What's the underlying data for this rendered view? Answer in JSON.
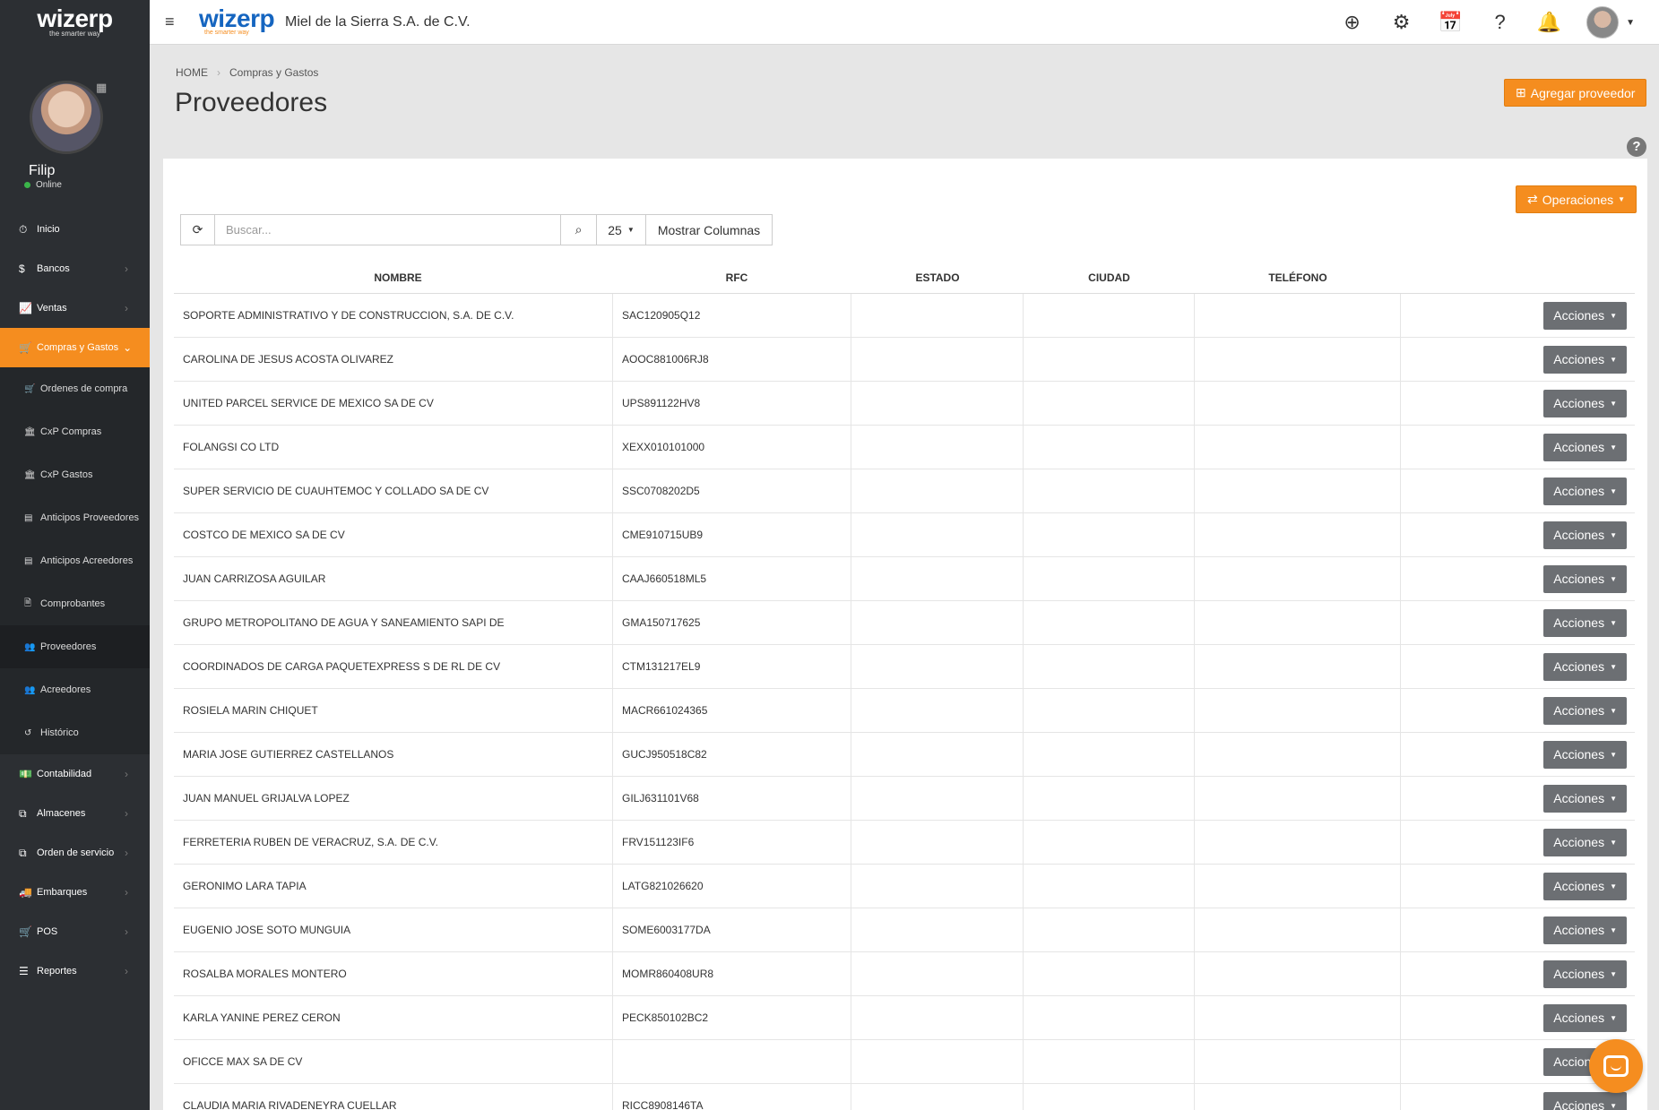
{
  "sidebar": {
    "logo": {
      "word": "wizerp",
      "tag": "the smarter way"
    },
    "user": {
      "name": "Filip",
      "status": "Online"
    },
    "nav_top": [
      {
        "label": "Inicio",
        "icon": "dashboard-icon",
        "glyph": "⏱",
        "chevron": ""
      },
      {
        "label": "Bancos",
        "icon": "dollar-icon",
        "glyph": "$",
        "chevron": "›"
      },
      {
        "label": "Ventas",
        "icon": "line-chart-icon",
        "glyph": "📈",
        "chevron": "›"
      }
    ],
    "active_item": {
      "label": "Compras y Gastos",
      "icon": "cart-icon",
      "glyph": "🛒",
      "chevron": "⌄"
    },
    "sub_items": [
      {
        "label": "Ordenes de compra",
        "icon": "cart-icon",
        "glyph": "🛒"
      },
      {
        "label": "CxP Compras",
        "icon": "bank-icon",
        "glyph": "🏛"
      },
      {
        "label": "CxP Gastos",
        "icon": "bank-icon",
        "glyph": "🏛"
      },
      {
        "label": "Anticipos Proveedores",
        "icon": "list-icon",
        "glyph": "▤"
      },
      {
        "label": "Anticipos Acreedores",
        "icon": "list-icon",
        "glyph": "▤"
      },
      {
        "label": "Comprobantes",
        "icon": "file-icon",
        "glyph": "🗎"
      },
      {
        "label": "Proveedores",
        "icon": "users-icon",
        "glyph": "👥"
      },
      {
        "label": "Acreedores",
        "icon": "users-icon",
        "glyph": "👥"
      },
      {
        "label": "Histórico",
        "icon": "history-icon",
        "glyph": "↺"
      }
    ],
    "nav_bottom": [
      {
        "label": "Contabilidad",
        "icon": "money-icon",
        "glyph": "💵",
        "chevron": "›"
      },
      {
        "label": "Almacenes",
        "icon": "copy-icon",
        "glyph": "⧉",
        "chevron": "›"
      },
      {
        "label": "Orden de servicio",
        "icon": "copy-icon",
        "glyph": "⧉",
        "chevron": "›"
      },
      {
        "label": "Embarques",
        "icon": "truck-icon",
        "glyph": "🚚",
        "chevron": "›"
      },
      {
        "label": "POS",
        "icon": "cart-icon",
        "glyph": "🛒",
        "chevron": "›"
      },
      {
        "label": "Reportes",
        "icon": "report-icon",
        "glyph": "☰",
        "chevron": "›"
      }
    ]
  },
  "topbar": {
    "logo_word": "wizerp",
    "logo_tag": "the smarter way",
    "company": "Miel de la Sierra S.A. de C.V.",
    "icons": [
      {
        "name": "add-circle-icon",
        "glyph": "⊕"
      },
      {
        "name": "cogs-icon",
        "glyph": "⚙"
      },
      {
        "name": "calendar-icon",
        "glyph": "📅"
      },
      {
        "name": "question-icon",
        "glyph": "?"
      },
      {
        "name": "bell-icon",
        "glyph": "🔔"
      }
    ]
  },
  "header": {
    "breadcrumb": [
      "HOME",
      "Compras y Gastos"
    ],
    "title": "Proveedores",
    "add_button": "Agregar proveedor"
  },
  "panel": {
    "operations_button": "Operaciones",
    "search_placeholder": "Buscar...",
    "page_size": "25",
    "columns_button": "Mostrar Columnas"
  },
  "table": {
    "headers": [
      "NOMBRE",
      "RFC",
      "ESTADO",
      "CIUDAD",
      "TELÉFONO",
      ""
    ],
    "action_label": "Acciones",
    "rows": [
      {
        "nombre": "SOPORTE ADMINISTRATIVO Y DE CONSTRUCCION, S.A. DE C.V.",
        "rfc": "SAC120905Q12",
        "estado": "",
        "ciudad": "",
        "telefono": ""
      },
      {
        "nombre": "CAROLINA DE JESUS ACOSTA OLIVAREZ",
        "rfc": "AOOC881006RJ8",
        "estado": "",
        "ciudad": "",
        "telefono": ""
      },
      {
        "nombre": "UNITED PARCEL SERVICE DE MEXICO SA DE CV",
        "rfc": "UPS891122HV8",
        "estado": "",
        "ciudad": "",
        "telefono": ""
      },
      {
        "nombre": "FOLANGSI CO LTD",
        "rfc": "XEXX010101000",
        "estado": "",
        "ciudad": "",
        "telefono": ""
      },
      {
        "nombre": "SUPER SERVICIO DE CUAUHTEMOC Y COLLADO SA DE CV",
        "rfc": "SSC0708202D5",
        "estado": "",
        "ciudad": "",
        "telefono": ""
      },
      {
        "nombre": "COSTCO DE MEXICO SA DE CV",
        "rfc": "CME910715UB9",
        "estado": "",
        "ciudad": "",
        "telefono": ""
      },
      {
        "nombre": "JUAN CARRIZOSA AGUILAR",
        "rfc": "CAAJ660518ML5",
        "estado": "",
        "ciudad": "",
        "telefono": ""
      },
      {
        "nombre": "GRUPO METROPOLITANO DE AGUA Y SANEAMIENTO SAPI DE",
        "rfc": "GMA150717625",
        "estado": "",
        "ciudad": "",
        "telefono": ""
      },
      {
        "nombre": "COORDINADOS DE CARGA PAQUETEXPRESS S DE RL DE CV",
        "rfc": "CTM131217EL9",
        "estado": "",
        "ciudad": "",
        "telefono": ""
      },
      {
        "nombre": "ROSIELA MARIN CHIQUET",
        "rfc": "MACR661024365",
        "estado": "",
        "ciudad": "",
        "telefono": ""
      },
      {
        "nombre": "MARIA JOSE GUTIERREZ CASTELLANOS",
        "rfc": "GUCJ950518C82",
        "estado": "",
        "ciudad": "",
        "telefono": ""
      },
      {
        "nombre": "JUAN MANUEL GRIJALVA LOPEZ",
        "rfc": "GILJ631101V68",
        "estado": "",
        "ciudad": "",
        "telefono": ""
      },
      {
        "nombre": "FERRETERIA RUBEN DE VERACRUZ, S.A. DE C.V.",
        "rfc": "FRV151123IF6",
        "estado": "",
        "ciudad": "",
        "telefono": ""
      },
      {
        "nombre": "GERONIMO LARA TAPIA",
        "rfc": "LATG821026620",
        "estado": "",
        "ciudad": "",
        "telefono": ""
      },
      {
        "nombre": "EUGENIO JOSE SOTO MUNGUIA",
        "rfc": "SOME6003177DA",
        "estado": "",
        "ciudad": "",
        "telefono": ""
      },
      {
        "nombre": "ROSALBA MORALES MONTERO",
        "rfc": "MOMR860408UR8",
        "estado": "",
        "ciudad": "",
        "telefono": ""
      },
      {
        "nombre": "KARLA YANINE PEREZ CERON",
        "rfc": "PECK850102BC2",
        "estado": "",
        "ciudad": "",
        "telefono": ""
      },
      {
        "nombre": "OFICCE MAX SA DE CV",
        "rfc": "",
        "estado": "",
        "ciudad": "",
        "telefono": ""
      },
      {
        "nombre": "CLAUDIA MARIA RIVADENEYRA CUELLAR",
        "rfc": "RICC8908146TA",
        "estado": "",
        "ciudad": "",
        "telefono": ""
      }
    ]
  },
  "colors": {
    "accent": "#f58d1f",
    "sidebar": "#2c2f33",
    "action_button": "#6c6f73",
    "logo_blue": "#1565c0"
  }
}
